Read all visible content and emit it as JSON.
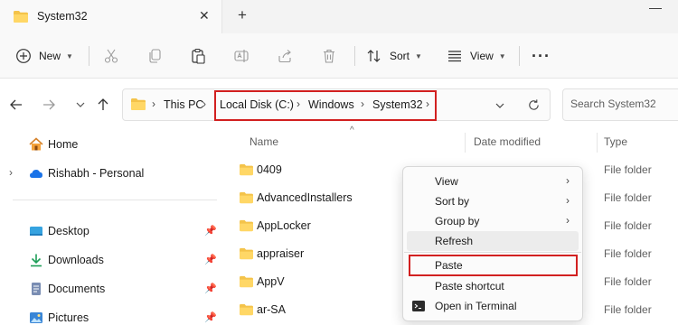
{
  "window": {
    "tab_title": "System32",
    "tab_close_icon": "✕",
    "new_tab_icon": "+",
    "minimize_icon": "—"
  },
  "toolbar": {
    "new_label": "New",
    "sort_label": "Sort",
    "view_label": "View",
    "more_label": "···",
    "icons": [
      "add-icon",
      "cut-icon",
      "copy-icon",
      "paste-icon",
      "rename-icon",
      "share-icon",
      "delete-icon",
      "sort-icon",
      "view-icon",
      "more-icon"
    ]
  },
  "address": {
    "path": [
      "This PC",
      "Local Disk (C:)",
      "Windows",
      "System32"
    ],
    "search_placeholder": "Search System32"
  },
  "sidebar": {
    "items": [
      {
        "label": "Home",
        "icon": "home-icon"
      },
      {
        "label": "Rishabh - Personal",
        "icon": "cloud-icon"
      },
      {
        "label": "Desktop",
        "icon": "desktop-icon",
        "pinned": true
      },
      {
        "label": "Downloads",
        "icon": "download-icon",
        "pinned": true
      },
      {
        "label": "Documents",
        "icon": "document-icon",
        "pinned": true
      },
      {
        "label": "Pictures",
        "icon": "picture-icon",
        "pinned": true
      }
    ]
  },
  "filelist": {
    "columns": [
      "Name",
      "Date modified",
      "Type"
    ],
    "rows": [
      {
        "name": "0409",
        "type": "File folder"
      },
      {
        "name": "AdvancedInstallers",
        "type": "File folder"
      },
      {
        "name": "AppLocker",
        "type": "File folder"
      },
      {
        "name": "appraiser",
        "type": "File folder"
      },
      {
        "name": "AppV",
        "type": "File folder"
      },
      {
        "name": "ar-SA",
        "type": "File folder"
      }
    ]
  },
  "context_menu": {
    "items": [
      "View",
      "Sort by",
      "Group by",
      "Refresh",
      "Paste",
      "Paste shortcut",
      "Open in Terminal"
    ]
  },
  "colors": {
    "highlight": "#d22020",
    "folder": "#f4c34a",
    "accent": "#0067c0"
  }
}
